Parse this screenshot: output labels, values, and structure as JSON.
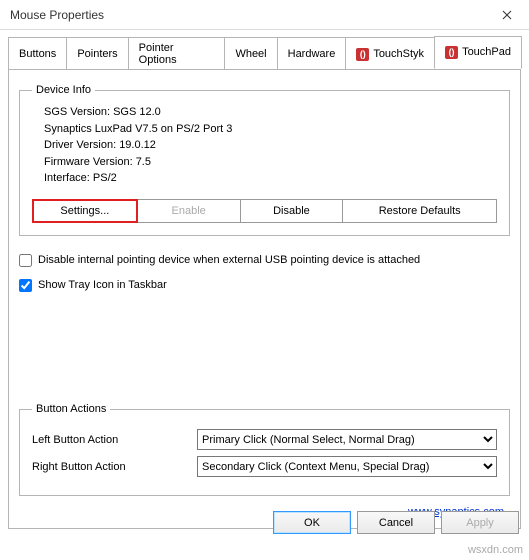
{
  "window": {
    "title": "Mouse Properties"
  },
  "tabs": {
    "t0": "Buttons",
    "t1": "Pointers",
    "t2": "Pointer Options",
    "t3": "Wheel",
    "t4": "Hardware",
    "t5": "TouchStyk",
    "t6": "TouchPad"
  },
  "deviceInfo": {
    "legend": "Device Info",
    "l1": "SGS Version: SGS 12.0",
    "l2": "Synaptics LuxPad V7.5 on PS/2 Port 3",
    "l3": "Driver Version: 19.0.12",
    "l4": "Firmware Version: 7.5",
    "l5": "Interface: PS/2"
  },
  "buttons": {
    "settings": "Settings...",
    "enable": "Enable",
    "disable": "Disable",
    "restore": "Restore Defaults"
  },
  "checkboxes": {
    "disableInternal": "Disable internal pointing device when external USB pointing device is attached",
    "showTray": "Show Tray Icon in Taskbar"
  },
  "buttonActions": {
    "legend": "Button Actions",
    "leftLabel": "Left Button Action",
    "leftValue": "Primary Click (Normal Select, Normal Drag)",
    "rightLabel": "Right Button Action",
    "rightValue": "Secondary Click (Context Menu, Special Drag)"
  },
  "link": "www.synaptics.com",
  "footer": {
    "ok": "OK",
    "cancel": "Cancel",
    "apply": "Apply"
  },
  "watermark": "wsxdn.com"
}
